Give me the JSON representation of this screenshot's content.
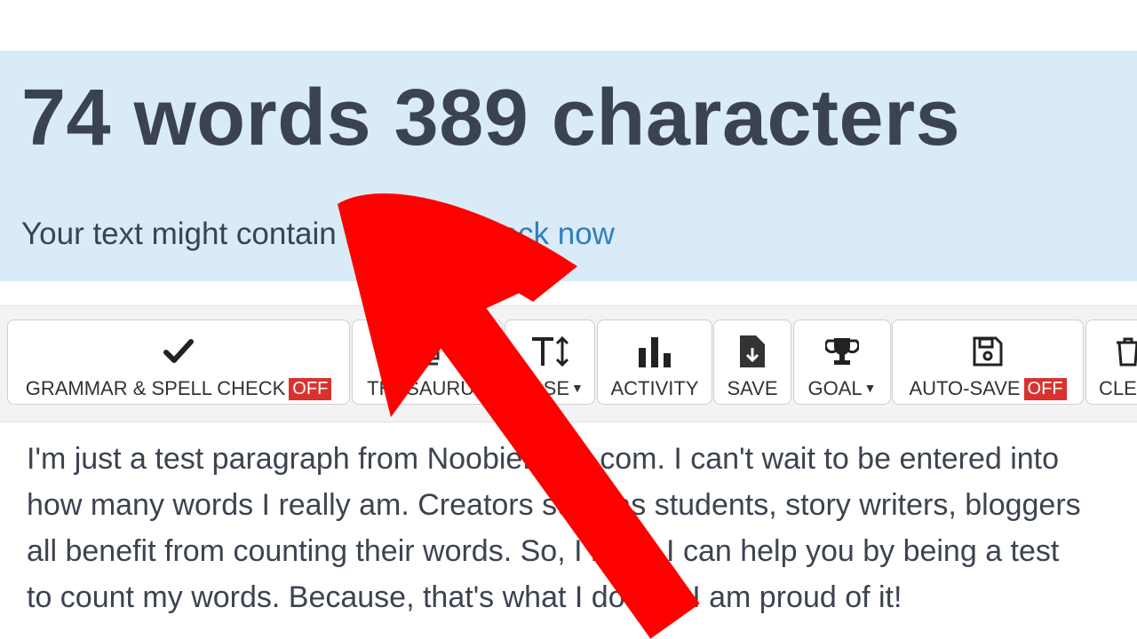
{
  "stats": {
    "words_count": "74",
    "words_label": "words",
    "characters_count": "389",
    "characters_label": "characters"
  },
  "notice": {
    "text": "Your text might contain issues - ",
    "link": "Check now"
  },
  "toolbar": {
    "grammar": {
      "label": "GRAMMAR & SPELL CHECK",
      "badge": "OFF"
    },
    "thesaurus": {
      "label": "THESAURUS"
    },
    "case": {
      "label": "CASE"
    },
    "activity": {
      "label": "ACTIVITY"
    },
    "save": {
      "label": "SAVE"
    },
    "goal": {
      "label": "GOAL"
    },
    "autosave": {
      "label": "AUTO-SAVE",
      "badge": "OFF"
    },
    "clear": {
      "label": "CLEAR"
    }
  },
  "editor": {
    "lines": [
      "I'm just a test paragraph from NoobieEcho.com. I can't wait to be entered into",
      "how many words I really am. Creators such as students, story writers, bloggers",
      "all benefit from counting their words. So, I hope I can help you by being a test",
      "to count my words. Because, that's what I do and I am proud of it!"
    ]
  },
  "colors": {
    "banner": "#d9ebf7",
    "link": "#2f7fc1",
    "badge": "#d9322e",
    "arrow": "#ff0000"
  },
  "icons": {
    "grammar": "checkmark-icon",
    "thesaurus": "book-icon",
    "case": "text-height-icon",
    "activity": "bar-chart-icon",
    "save": "file-download-icon",
    "goal": "trophy-icon",
    "autosave": "floppy-disk-icon",
    "clear": "trash-icon"
  }
}
